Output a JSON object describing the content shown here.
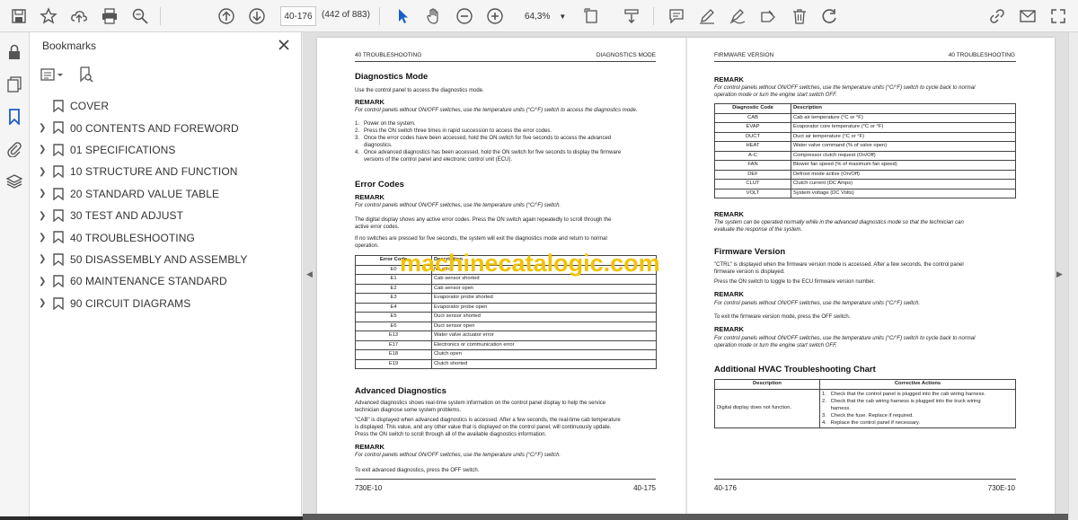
{
  "toolbar": {
    "page_current": "40-176",
    "page_count": "(442 of 883)",
    "zoom": "64,3%"
  },
  "bookmarks": {
    "title": "Bookmarks",
    "items": [
      {
        "label": "COVER",
        "expandable": false
      },
      {
        "label": "00 CONTENTS AND FOREWORD",
        "expandable": true
      },
      {
        "label": "01 SPECIFICATIONS",
        "expandable": true
      },
      {
        "label": "10 STRUCTURE AND FUNCTION",
        "expandable": true
      },
      {
        "label": "20 STANDARD VALUE TABLE",
        "expandable": true
      },
      {
        "label": "30 TEST AND ADJUST",
        "expandable": true
      },
      {
        "label": "40 TROUBLESHOOTING",
        "expandable": true
      },
      {
        "label": "50 DISASSEMBLY AND ASSEMBLY",
        "expandable": true
      },
      {
        "label": "60 MAINTENANCE STANDARD",
        "expandable": true
      },
      {
        "label": "90 CIRCUIT DIAGRAMS",
        "expandable": true
      }
    ]
  },
  "left_page": {
    "header_left": "40 TROUBLESHOOTING",
    "header_right": "DIAGNOSTICS MODE",
    "h_diag": "Diagnostics Mode",
    "diag_intro": "Use the control panel to access the diagnostics mode.",
    "remark": "REMARK",
    "remark_units": "For control panels without ON/OFF switches, use the temperature units (°C/°F) switch to access the diagnostics mode.",
    "steps": [
      "1.   Power on the system.",
      "2.   Press the ON switch three times in rapid succession to access the error codes.",
      "3.   Once the error codes have been accessed, hold the ON switch for five seconds to access the advanced",
      "      diagnostics.",
      "4.   Once advanced diagnostics has been accessed, hold the ON switch for five seconds to display the firmware",
      "      versions of the control panel and electronic control unit (ECU)."
    ],
    "h_error": "Error Codes",
    "remark_error": "For control panels without ON/OFF switches, use the temperature units (°C/°F) switch.",
    "error_text1": "The digital display shows any active error codes. Press the ON switch again repeatedly to scroll through the",
    "error_text1b": "active error codes.",
    "error_text2": "If no switches are pressed for five seconds, the system will exit the diagnostics mode and return to normal",
    "error_text2b": "operation.",
    "error_table": {
      "headers": [
        "Error Code",
        "Description"
      ],
      "rows": [
        [
          "E0",
          "No error"
        ],
        [
          "E1",
          "Cab sensor shorted"
        ],
        [
          "E2",
          "Cab sensor open"
        ],
        [
          "E3",
          "Evaporator probe shorted"
        ],
        [
          "E4",
          "Evaporator probe open"
        ],
        [
          "E5",
          "Duct sensor shorted"
        ],
        [
          "E6",
          "Duct sensor open"
        ],
        [
          "E13",
          "Water valve actuator error"
        ],
        [
          "E17",
          "Electronics or communication error"
        ],
        [
          "E18",
          "Clutch open"
        ],
        [
          "E19",
          "Clutch shorted"
        ]
      ]
    },
    "h_adv": "Advanced Diagnostics",
    "adv_text1": "Advanced diagnostics shows real-time system information on the control panel display to help the service",
    "adv_text1b": "technician diagnose some system problems.",
    "adv_text2": "\"CAB\" is displayed when advanced diagnostics is accessed. After a few seconds, the real-time cab temperature",
    "adv_text2b": "is displayed. This value, and any other value that is displayed on the control panel, will continuously update.",
    "adv_text2c": "Press the ON switch to scroll through all of the available diagnostics information.",
    "remark_adv": "For control panels without ON/OFF switches, use the temperature units (°C/°F) switch.",
    "adv_exit": "To exit advanced diagnostics, press the OFF switch.",
    "footer_left": "730E-10",
    "footer_right": "40-175"
  },
  "right_page": {
    "header_left": "FIRMWARE VERSION",
    "header_right": "40 TROUBLESHOOTING",
    "remark": "REMARK",
    "remark_top": "For control panels without ON/OFF switches, use the temperature units (°C/°F) switch to cycle back to normal",
    "remark_top_b": "operation mode or turn the engine start switch OFF.",
    "diag_table": {
      "headers": [
        "Diagnostic Code",
        "Description"
      ],
      "rows": [
        [
          "CAB",
          "Cab air temperature (°C or °F)"
        ],
        [
          "EVAP",
          "Evaporator core temperature (°C or °F)"
        ],
        [
          "DUCT",
          "Duct air temperature (°C or °F)"
        ],
        [
          "HEAT",
          "Water valve command (% of valve open)"
        ],
        [
          "A-C",
          "Compressor clutch request (On/Off)"
        ],
        [
          "FAN",
          "Blower fan speed (% of maximum fan speed)"
        ],
        [
          "DEF",
          "Defrost mode active (On/Off)"
        ],
        [
          "CLUT",
          "Clutch current (DC Amps)"
        ],
        [
          "VOLT",
          "System voltage (DC Volts)"
        ]
      ]
    },
    "remark_sys": "The system can be operated normally while in the advanced diagnostics mode so that the technician can",
    "remark_sys_b": "evaluate the response of the system.",
    "h_fw": "Firmware Version",
    "fw_text1": "\"CTRL\" is displayed when the firmware version mode is accessed. After a few seconds, the control panel",
    "fw_text1b": "firmware version is displayed.",
    "fw_text2": "Press the ON switch to toggle to the ECU firmware version number.",
    "remark_fw": "For control panels without ON/OFF switches, use the temperature units (°C/°F) switch.",
    "fw_exit": "To exit the firmware version mode, press the OFF switch.",
    "remark_fw2": "For control panels without ON/OFF switches, use the temperature units (°C/°F) switch to cycle back to normal",
    "remark_fw2b": "operation mode or turn the engine start switch OFF.",
    "h_hvac": "Additional HVAC Troubleshooting Chart",
    "hvac_table": {
      "headers": [
        "Description",
        "Corrective Actions"
      ],
      "description": "Digital display does not function.",
      "actions": [
        "1.   Check that the control panel is plugged into the cab wiring harness.",
        "2.   Check that the cab wiring harness is plugged into the truck wiring",
        "      harness.",
        "3.   Check the fuse. Replace if required.",
        "4.   Replace the control panel if necessary."
      ]
    },
    "footer_left": "40-176",
    "footer_right": "730E-10"
  },
  "watermark": "machinecatalogic.com"
}
